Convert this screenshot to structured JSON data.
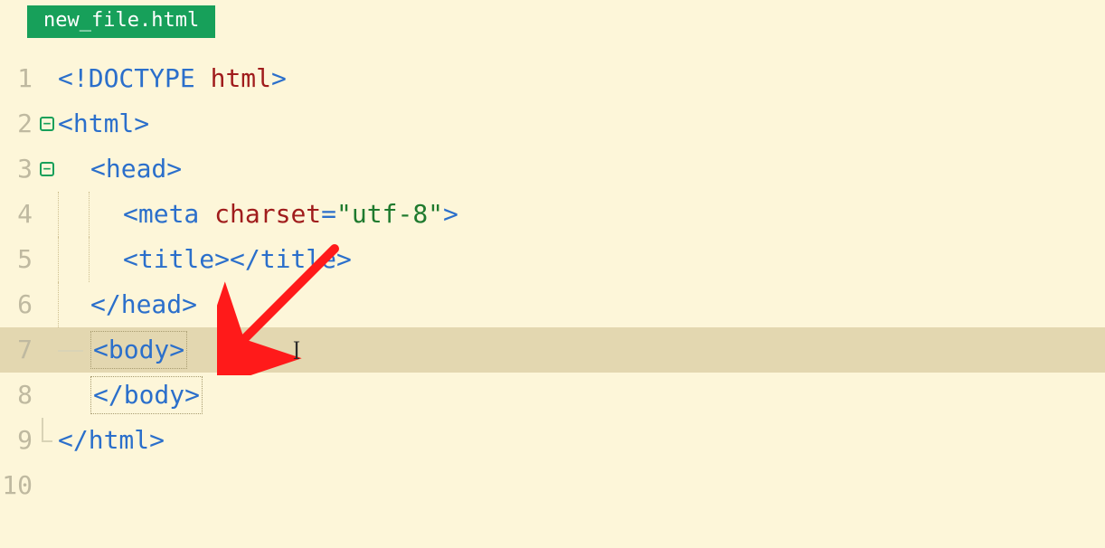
{
  "tab": {
    "filename": "new_file.html"
  },
  "gutter": {
    "l1": "1",
    "l2": "2",
    "l3": "3",
    "l4": "4",
    "l5": "5",
    "l6": "6",
    "l7": "7",
    "l8": "8",
    "l9": "9",
    "l10": "10"
  },
  "fold": {
    "minus": "−"
  },
  "code": {
    "lt": "<",
    "gt": ">",
    "slash": "/",
    "bang": "!",
    "eq": "=",
    "doctype": "DOCTYPE",
    "html_kw": "html",
    "html": "html",
    "head": "head",
    "meta": "meta",
    "charset": "charset",
    "utf8": "\"utf-8\"",
    "title": "title",
    "body": "body"
  },
  "cursor": {
    "ibeam": "I"
  }
}
